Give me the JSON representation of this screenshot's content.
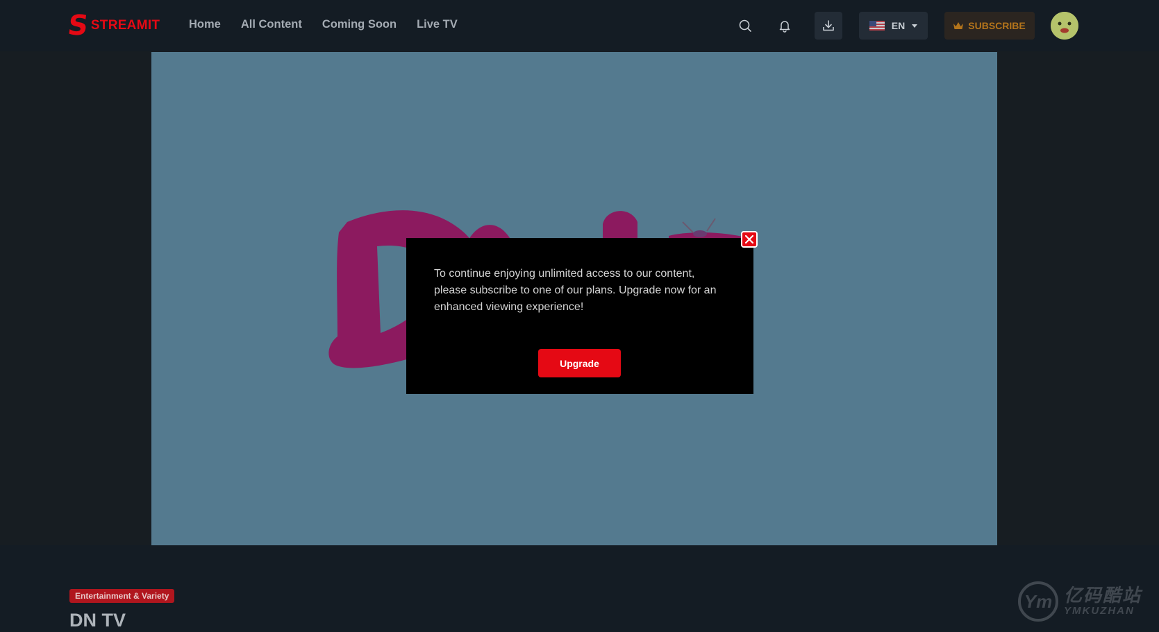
{
  "app": {
    "logo_letter": "S",
    "logo_text": "STREAMIT"
  },
  "nav": {
    "items": [
      "Home",
      "All Content",
      "Coming Soon",
      "Live TV"
    ]
  },
  "header": {
    "search_icon": "search-icon",
    "notification_icon": "bell-icon",
    "download_icon": "download-icon",
    "language": "EN",
    "language_flag": "us-flag-icon",
    "subscribe_label": "SUBSCRIBE",
    "subscribe_icon": "crown-icon"
  },
  "modal": {
    "message": "To continue enjoying unlimited access to our content, please subscribe to one of our plans. Upgrade now for an enhanced viewing experience!",
    "upgrade_label": "Upgrade",
    "close_icon": "close-icon"
  },
  "content": {
    "genre": "Entertainment & Variety",
    "title": "DN TV"
  },
  "watermark": {
    "cn": "亿码酷站",
    "en": "YMKUZHAN",
    "mark": "Ym"
  },
  "colors": {
    "accent": "#e50914",
    "background": "#141c24",
    "player_bg": "#547a8f",
    "brand_magenta": "#8c1a5f",
    "subscribe_text": "#b3741b"
  }
}
